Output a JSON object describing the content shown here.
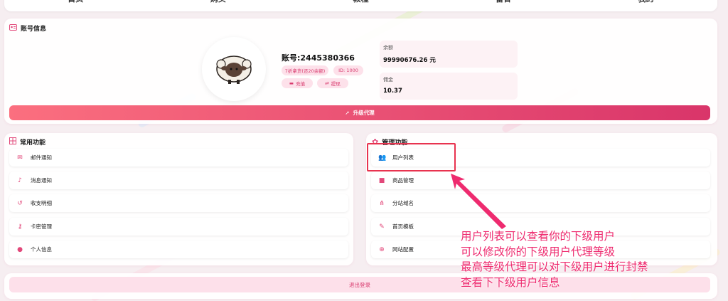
{
  "nav": {
    "items": [
      "首页",
      "购买",
      "教程",
      "留言",
      "我的"
    ]
  },
  "account": {
    "section_title": "账号信息",
    "name": "账号:2445380366",
    "level_badge": "7折拿货(还20余额)",
    "id_badge": "ID: 1000",
    "recharge_label": "充值",
    "withdraw_label": "提现",
    "balance_label": "余额",
    "balance_value": "99990676.26 元",
    "commission_label": "佣金",
    "commission_value": "10.37",
    "upgrade_label": "升级代理"
  },
  "common": {
    "title": "常用功能",
    "items": [
      {
        "label": "邮件通知",
        "icon": "mail-icon"
      },
      {
        "label": "消息通知",
        "icon": "bell-icon"
      },
      {
        "label": "收支明细",
        "icon": "history-icon"
      },
      {
        "label": "卡密管理",
        "icon": "key-icon"
      },
      {
        "label": "个人信息",
        "icon": "user-icon"
      }
    ]
  },
  "admin": {
    "title": "管理功能",
    "items": [
      {
        "label": "用户列表",
        "icon": "users-icon"
      },
      {
        "label": "商品管理",
        "icon": "bag-icon"
      },
      {
        "label": "分站域名",
        "icon": "sitemap-icon"
      },
      {
        "label": "首页模板",
        "icon": "brush-icon"
      },
      {
        "label": "网站配置",
        "icon": "globe-icon"
      }
    ]
  },
  "logout_label": "退出登录",
  "annotation": {
    "lines": [
      "用户列表可以查看你的下级用户",
      "可以修改你的下级用户代理等级",
      "最高等级代理可以对下级用户进行封禁",
      "查看下下级用户信息"
    ]
  },
  "colors": {
    "accent": "#e2487a",
    "annotation": "#ee2b6f",
    "highlight_border": "#e8334f"
  }
}
